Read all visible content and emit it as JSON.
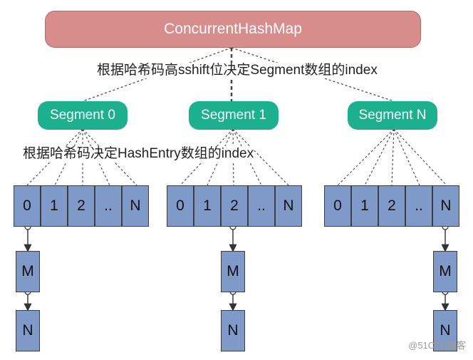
{
  "root": {
    "label": "ConcurrentHashMap"
  },
  "captions": {
    "top": "根据哈希码高sshift位决定Segment数组的index",
    "segment": "根据哈希码决定HashEntry数组的index"
  },
  "segments": [
    {
      "label": "Segment 0",
      "cells": [
        "0",
        "1",
        "2",
        "..",
        "N"
      ],
      "chain": [
        "M",
        "N"
      ]
    },
    {
      "label": "Segment 1",
      "cells": [
        "0",
        "1",
        "2",
        "..",
        "N"
      ],
      "chain": [
        "M",
        "N"
      ]
    },
    {
      "label": "Segment N",
      "cells": [
        "0",
        "1",
        "2",
        "..",
        "N"
      ],
      "chain": [
        "M",
        "N"
      ]
    }
  ],
  "watermark": "@51CTO博客",
  "colors": {
    "root": "#d98c8c",
    "segment": "#1db08f",
    "cell": "#7f99c8",
    "line": "#333333"
  }
}
